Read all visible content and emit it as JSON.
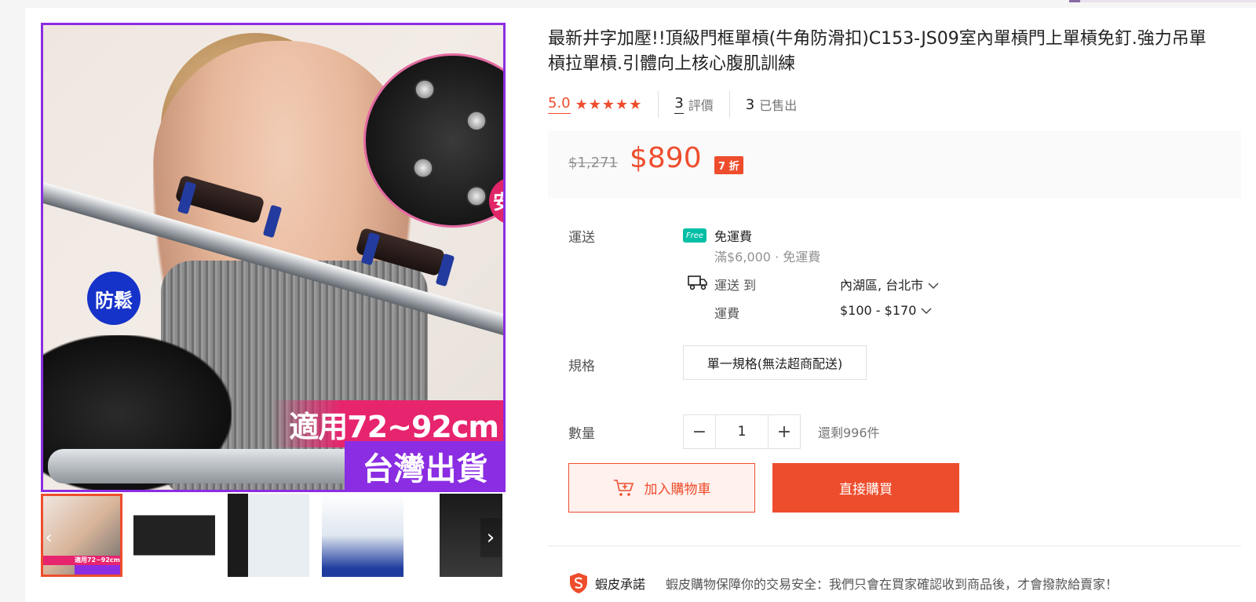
{
  "product": {
    "title": "最新井字加壓!!頂級門框單槓(牛角防滑扣)C153-JS09室內單槓門上單槓免釘.強力吊單槓拉單槓.引體向上核心腹肌訓練",
    "image_badges": {
      "safe": "安全",
      "anti_loose": "防鬆",
      "size": "適用72~92cm",
      "origin": "台灣出貨"
    }
  },
  "rating": {
    "score": "5.0",
    "stars": "★★★★★",
    "reviews_count": "3",
    "reviews_label": "評價",
    "sold_count": "3",
    "sold_label": "已售出"
  },
  "price": {
    "original": "$1,271",
    "current": "$890",
    "discount": "7 折"
  },
  "shipping": {
    "label": "運送",
    "free_badge": "Free",
    "free_title": "免運費",
    "free_condition": "滿$6,000 · 免運費",
    "ship_to_label": "運送 到",
    "ship_to_value": "內湖區, 台北市",
    "fee_label": "運費",
    "fee_value": "$100 - $170"
  },
  "variant": {
    "label": "規格",
    "option": "單一規格(無法超商配送)"
  },
  "quantity": {
    "label": "數量",
    "minus": "−",
    "value": "1",
    "plus": "+",
    "stock": "還剩996件"
  },
  "actions": {
    "add_to_cart": "加入購物車",
    "buy_now": "直接購買"
  },
  "guarantee": {
    "title": "蝦皮承諾",
    "text": "蝦皮購物保障你的交易安全：我們只會在買家確認收到商品後，才會撥款給賣家！"
  },
  "gallery": {
    "next": "›",
    "prev": "‹",
    "thumb_caption": "適用72~92cm"
  },
  "colors": {
    "accent": "#ee4d2d",
    "image_border": "#8b2de2",
    "free_ship": "#00bfa5"
  }
}
